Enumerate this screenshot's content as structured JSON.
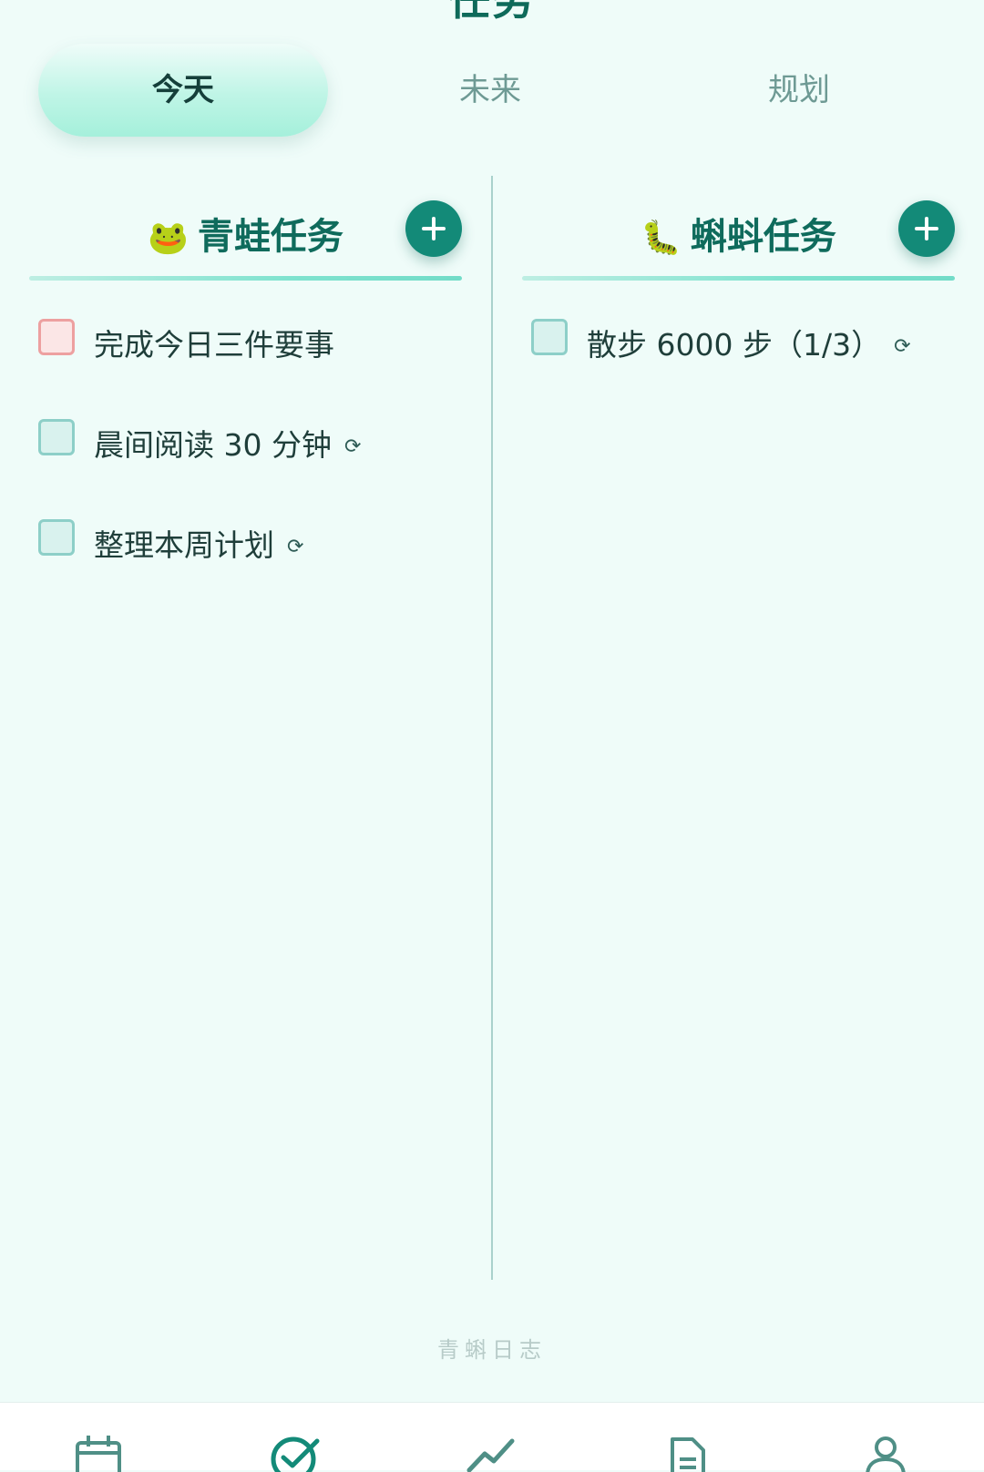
{
  "header": {
    "title": "任务"
  },
  "tabs": [
    {
      "label": "今天",
      "active": true
    },
    {
      "label": "未来",
      "active": false
    },
    {
      "label": "规划",
      "active": false
    }
  ],
  "columns": {
    "frog": {
      "emoji": "🐸",
      "title": "青蛙任务",
      "tasks": [
        {
          "text": "完成今日三件要事",
          "repeat": false,
          "checked": false,
          "priority": "high"
        },
        {
          "text": "晨间阅读 30 分钟",
          "repeat": true,
          "checked": false
        },
        {
          "text": "整理本周计划",
          "repeat": true,
          "checked": false
        }
      ]
    },
    "tadpole": {
      "emoji": "🐛",
      "title": "蝌蚪任务",
      "tasks": [
        {
          "text": "散步 6000 步（1/3）",
          "repeat": true,
          "checked": false
        }
      ]
    }
  },
  "repeat_symbol": "⟳",
  "footer": {
    "brand": "青蝌日志"
  },
  "bottom_nav": {
    "items": [
      {
        "icon": "calendar-icon"
      },
      {
        "icon": "check-circle-icon",
        "active": true
      },
      {
        "icon": "trend-chart-icon"
      },
      {
        "icon": "document-icon"
      },
      {
        "icon": "user-icon"
      }
    ]
  },
  "colors": {
    "background": "#effcf9",
    "primary": "#138a78",
    "title": "#0f6b5c",
    "urgent_checkbox": "#eda0a0",
    "checkbox": "#8dcfc8"
  }
}
